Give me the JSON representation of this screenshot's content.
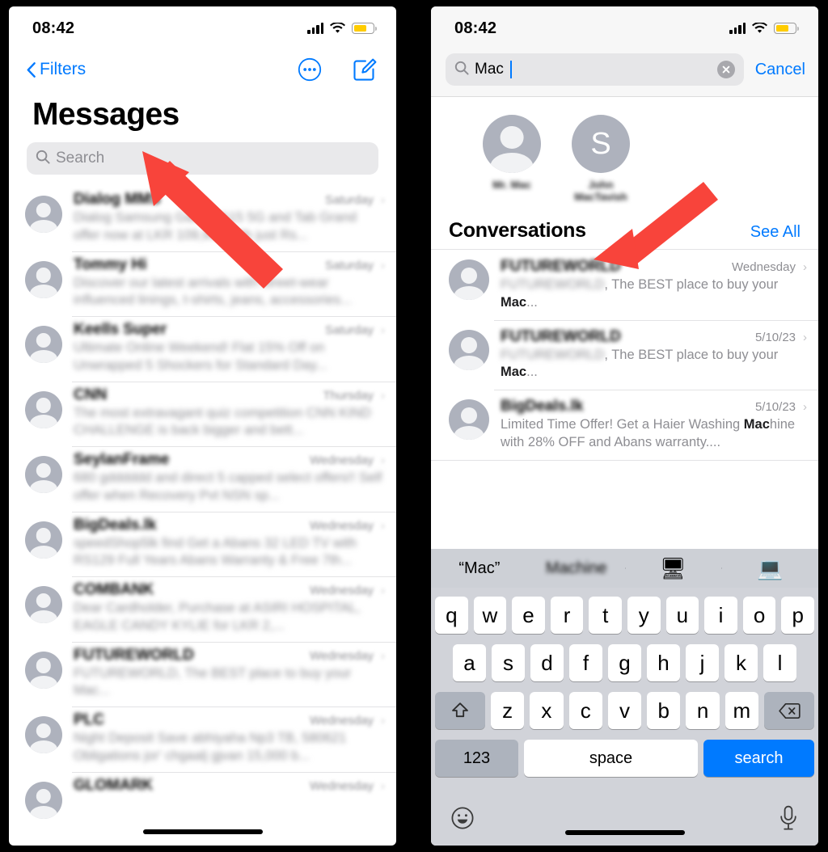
{
  "meta": {
    "accent_blue": "#007aff",
    "battery_yellow": "#ffcc00",
    "arrow_red": "#f8443b"
  },
  "left_phone": {
    "status": {
      "time": "08:42",
      "signal": "cellular-bars-icon",
      "wifi": "wifi-icon",
      "battery": "battery-low-power-icon"
    },
    "nav": {
      "back_label": "Filters",
      "more_icon": "more-circle-icon",
      "compose_icon": "compose-icon"
    },
    "title": "Messages",
    "search": {
      "placeholder": "Search",
      "value": "",
      "icon": "search-icon"
    },
    "messages": [
      {
        "name": "Dialog MMS",
        "date": "Saturday",
        "preview": "Dialog Samsung Galaxy A15 5G and Tab Grand offer now at LKR 109,999 with just Rs...",
        "redacted": true
      },
      {
        "name": "Tommy Hi",
        "date": "Saturday",
        "preview": "Discover our latest arrivals with street-wear influenced linings, t-shirts, jeans, accessories...",
        "redacted": true
      },
      {
        "name": "Keells Super",
        "date": "Saturday",
        "preview": "Ultimate Online Weekend! Flat 15% Off on Unwrapped 5 Shockers for Standard Day...",
        "redacted": true
      },
      {
        "name": "CNN",
        "date": "Thursday",
        "preview": "The most extravagant quiz competition CNN KIND CHALLENGE is back bigger and bett...",
        "redacted": true
      },
      {
        "name": "SeylanFrame",
        "date": "Wednesday",
        "preview": "680 gdddddd and direct 5 capped select offers!! Self offer when Recovery Pvt NSN sp...",
        "redacted": true
      },
      {
        "name": "BigDeals.lk",
        "date": "Wednesday",
        "preview": "speedShop5lk find Get a Abans 32 LED TV with RS129 Full Years Abans Warranty & Free 7th...",
        "redacted": true
      },
      {
        "name": "COMBANK",
        "date": "Wednesday",
        "preview": "Dear Cardholder, Purchase at ASIRI HOSPITAL, EAGLE CANDY KYLIE for LKR 2,...",
        "redacted": true
      },
      {
        "name": "FUTUREWORLD",
        "date": "Wednesday",
        "preview": "FUTUREWORLD, The BEST place to buy your Mac...",
        "redacted": true
      },
      {
        "name": "PLC",
        "date": "Wednesday",
        "preview": "Night Deposit Save abhiyaha Np3 TB, 580621 Obligations jor' chgaalj gjvan 15,000 b...",
        "redacted": true
      },
      {
        "name": "GLOMARK",
        "date": "Wednesday",
        "preview": "",
        "redacted": true
      }
    ]
  },
  "right_phone": {
    "status": {
      "time": "08:42",
      "signal": "cellular-bars-icon",
      "wifi": "wifi-icon",
      "battery": "battery-low-power-icon"
    },
    "search": {
      "value": "Mac",
      "icon": "search-icon",
      "clear_icon": "clear-circle-icon",
      "cancel_label": "Cancel"
    },
    "contacts": [
      {
        "name": "Mr. Mac",
        "avatar_type": "person",
        "initial": "",
        "redacted": true
      },
      {
        "name": "John MacTavish",
        "avatar_type": "initial",
        "initial": "S",
        "redacted": true
      }
    ],
    "conversations_section": {
      "title": "Conversations",
      "see_all_label": "See All"
    },
    "conversations": [
      {
        "name": "FUTUREWORLD",
        "name_redacted": true,
        "date": "Wednesday",
        "preview_prefix": "FUTUREWORLD",
        "preview_prefix_redacted": true,
        "preview_rest": ", The BEST place to buy your ",
        "preview_match": "Mac",
        "preview_tail": "..."
      },
      {
        "name": "FUTUREWORLD",
        "name_redacted": true,
        "date": "5/10/23",
        "preview_prefix": "FUTUREWORLD",
        "preview_prefix_redacted": true,
        "preview_rest": ", The BEST place to buy your ",
        "preview_match": "Mac",
        "preview_tail": "..."
      },
      {
        "name": "BigDeals.lk",
        "name_redacted": true,
        "date": "5/10/23",
        "preview_prefix": "",
        "preview_prefix_redacted": false,
        "preview_rest": "Limited Time Offer! Get a Haier Washing ",
        "preview_match": "Mac",
        "preview_tail": "hine with 28% OFF and Abans warranty...."
      }
    ],
    "keyboard": {
      "predictions": [
        {
          "label": "“Mac”",
          "type": "text",
          "redacted": false
        },
        {
          "label": "Machine",
          "type": "text",
          "redacted": true
        },
        {
          "label": "🖥",
          "type": "emoji",
          "redacted": false
        },
        {
          "label": "💻",
          "type": "emoji",
          "redacted": false
        }
      ],
      "row1": [
        "q",
        "w",
        "e",
        "r",
        "t",
        "y",
        "u",
        "i",
        "o",
        "p"
      ],
      "row2": [
        "a",
        "s",
        "d",
        "f",
        "g",
        "h",
        "j",
        "k",
        "l"
      ],
      "row3": [
        "z",
        "x",
        "c",
        "v",
        "b",
        "n",
        "m"
      ],
      "shift_icon": "shift-icon",
      "backspace_icon": "backspace-icon",
      "numbers_label": "123",
      "space_label": "space",
      "return_label": "search",
      "emoji_icon": "emoji-icon",
      "mic_icon": "microphone-icon"
    }
  },
  "annotations": [
    {
      "name": "arrow-to-search-field",
      "target": "left search field"
    },
    {
      "name": "arrow-to-conversations",
      "target": "right conversations header"
    }
  ]
}
